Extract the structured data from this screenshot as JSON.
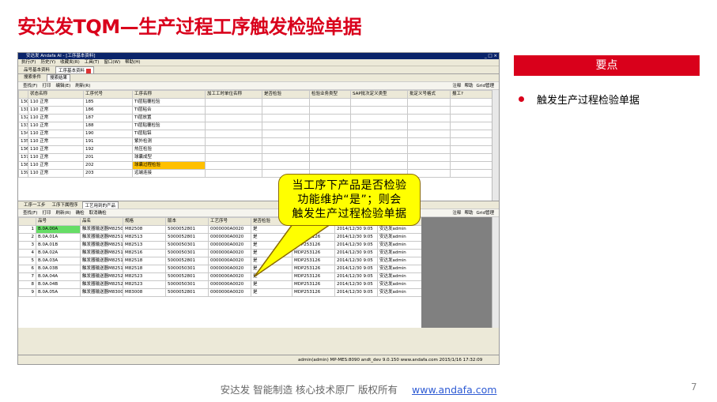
{
  "slide": {
    "title": "安达发TQM—生产过程工序触发检验单据",
    "side_header": "要点",
    "bullet": "触发生产过程检验单据",
    "callout": [
      "当工序下产品是否检验",
      "功能维护“是”；则会",
      "触发生产过程检验单据"
    ],
    "footer_text": "安达发   智能制造 核心技术原厂   版权所有",
    "footer_link": "www.andafa.com",
    "page_number": "7"
  },
  "app": {
    "window_title": "安达发 Andafa AI - [工序基本资料]",
    "window_controls": "_ □ ×",
    "menu": [
      "执行(F)",
      "历史(Y)",
      "收藏夹(R)",
      "工具(T)",
      "窗口(W)",
      "帮助(H)"
    ],
    "doc_tabs": [
      "品号基本资料",
      "工序基本资料"
    ],
    "sub_tabs": [
      "搜索条件",
      "搜索结果"
    ],
    "toolbar": [
      "查找(F)",
      "打印",
      "编辑(E)",
      "刷新(R)"
    ],
    "toolbar_right": [
      "注释",
      "帮助",
      "Grid管理"
    ],
    "upper_columns": [
      "",
      "状态名称",
      "工序代号",
      "工序名称",
      "加工工时单位名称",
      "是否检验",
      "检验业务类型",
      "SAP批次定义类型",
      "批定义号格式",
      "报工?"
    ],
    "upper_rows": [
      [
        "130",
        "110 正常",
        "185",
        "TI层贴覆检验",
        "",
        "",
        "",
        "",
        "",
        ""
      ],
      [
        "131",
        "110 正常",
        "186",
        "TI层粘合",
        "",
        "",
        "",
        "",
        "",
        ""
      ],
      [
        "132",
        "110 正常",
        "187",
        "TI层放置",
        "",
        "",
        "",
        "",
        "",
        ""
      ],
      [
        "133",
        "110 正常",
        "188",
        "TI层贴覆检验",
        "",
        "",
        "",
        "",
        "",
        ""
      ],
      [
        "134",
        "110 正常",
        "190",
        "TI层贴铝",
        "",
        "",
        "",
        "",
        "",
        ""
      ],
      [
        "135",
        "110 正常",
        "191",
        "紫外检测",
        "",
        "",
        "",
        "",
        "",
        ""
      ],
      [
        "136",
        "110 正常",
        "192",
        "热压检验",
        "",
        "",
        "",
        "",
        "",
        ""
      ],
      [
        "137",
        "110 正常",
        "201",
        "球囊成型",
        "",
        "",
        "",
        "",
        "",
        ""
      ],
      [
        "138",
        "110 正常",
        "202",
        "球囊过程检验",
        "",
        "",
        "",
        "",
        "",
        ""
      ],
      [
        "139",
        "110 正常",
        "203",
        "远端连接",
        "",
        "",
        "",
        "",
        "",
        ""
      ]
    ],
    "bottom_tabs": [
      "工序一工步",
      "工序下属程序",
      "工艺用到的产品"
    ],
    "lower_toolbar": [
      "查找(F)",
      "打印",
      "刷新(R)",
      "确检",
      "取消确检"
    ],
    "lower_columns": [
      "",
      "品号",
      "品名",
      "规格",
      "版本",
      "工艺序号",
      "是否检验",
      "更新主机",
      "更新时间",
      "更新人名称"
    ],
    "lower_rows": [
      [
        "1",
        "B.0A.00A",
        "触发器输送器M82508",
        "M82508",
        "5000052801",
        "0000000A0020",
        "是",
        "MDP253126",
        "2014/12/30 9:05",
        "安达发admin"
      ],
      [
        "2",
        "B.0A.01A",
        "触发器输送器M82513",
        "M82513",
        "5000052801",
        "0000000A0020",
        "是",
        "MDP253126",
        "2014/12/30 9:05",
        "安达发admin"
      ],
      [
        "3",
        "B.0A.01B",
        "触发器输送器M82513",
        "M82513",
        "5000050301",
        "0000000A0020",
        "是",
        "MDP253126",
        "2014/12/30 9:05",
        "安达发admin"
      ],
      [
        "4",
        "B.0A.02A",
        "触发器输送器M82516",
        "M82516",
        "5000050301",
        "0000000A0020",
        "是",
        "MDP253126",
        "2014/12/30 9:05",
        "安达发admin"
      ],
      [
        "5",
        "B.0A.03A",
        "触发器输送器M82518",
        "M82518",
        "5000052801",
        "0000000A0020",
        "是",
        "MDP253126",
        "2014/12/30 9:05",
        "安达发admin"
      ],
      [
        "6",
        "B.0A.03B",
        "触发器输送器M82518",
        "M82518",
        "5000050301",
        "0000000A0020",
        "是",
        "MDP253126",
        "2014/12/30 9:05",
        "安达发admin"
      ],
      [
        "7",
        "B.0A.04A",
        "触发器输送器M82523",
        "M82523",
        "5000052801",
        "0000000A0020",
        "是",
        "MDP253126",
        "2014/12/30 9:05",
        "安达发admin"
      ],
      [
        "8",
        "B.0A.04B",
        "触发器输送器M82523",
        "M82523",
        "5000050301",
        "0000000A0020",
        "是",
        "MDP253126",
        "2014/12/30 9:05",
        "安达发admin"
      ],
      [
        "9",
        "B.0A.05A",
        "触发器输送器M83008",
        "M83008",
        "5000052801",
        "0000000A0020",
        "是",
        "MDP253126",
        "2014/12/30 9:05",
        "安达发admin"
      ]
    ],
    "status_bar": "admin(admin)  MP-MES:8090  andt_dev  9.0.150  www.andafa.com  2015/1/16 17:32:09"
  },
  "colors": {
    "brand_red": "#d9001b",
    "highlight_orange": "#ffc000",
    "callout_yellow": "#ffff00",
    "row_green": "#66dd66",
    "link_blue": "#2e5bd4"
  }
}
